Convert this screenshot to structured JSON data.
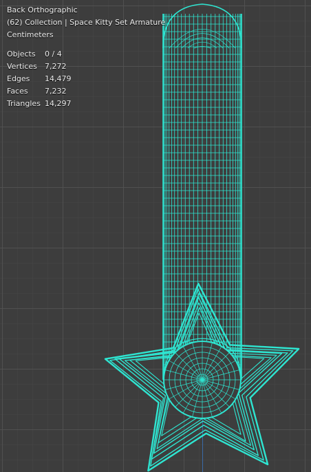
{
  "viewport": {
    "view_name": "Back Orthographic",
    "collection_line": "(62) Collection | Space Kitty Set Armature",
    "units": "Centimeters"
  },
  "stats": [
    {
      "label": "Objects",
      "value": "0 / 4"
    },
    {
      "label": "Vertices",
      "value": "7,272"
    },
    {
      "label": "Edges",
      "value": "14,479"
    },
    {
      "label": "Faces",
      "value": "7,232"
    },
    {
      "label": "Triangles",
      "value": "14,297"
    }
  ],
  "colors": {
    "wire": "#2ee6d2",
    "background": "#3d3d3d",
    "grid": "#525252",
    "axis_z": "#3a6aa8"
  }
}
